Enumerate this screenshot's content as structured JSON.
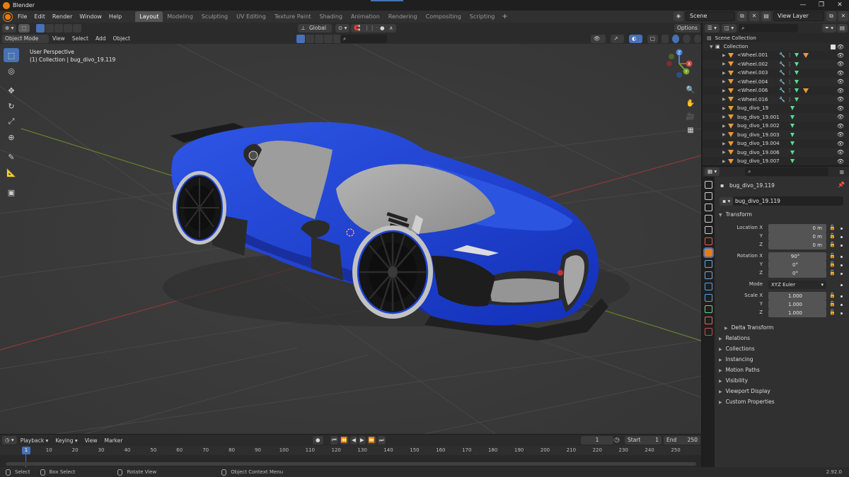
{
  "window": {
    "title": "Blender",
    "controls": [
      "—",
      "❐",
      "✕"
    ]
  },
  "menubar": {
    "menus": [
      "File",
      "Edit",
      "Render",
      "Window",
      "Help"
    ],
    "workspaces": [
      "Layout",
      "Modeling",
      "Sculpting",
      "UV Editing",
      "Texture Paint",
      "Shading",
      "Animation",
      "Rendering",
      "Compositing",
      "Scripting"
    ],
    "active_workspace": "Layout",
    "add_workspace": "+",
    "scene": "Scene",
    "view_layer": "View Layer"
  },
  "viewport_header": {
    "mode": "Object Mode",
    "menus": [
      "View",
      "Select",
      "Add",
      "Object"
    ],
    "orientation": "Global",
    "options": "Options"
  },
  "viewport": {
    "perspective": "User Perspective",
    "collection_info": "(1) Collection | bug_divo_19.119",
    "gizmo_axes": {
      "x": "X",
      "y": "Y",
      "z": "Z"
    },
    "accent_colors": {
      "car_body": "#1f3fc8",
      "x_axis": "#9c3a3a",
      "y_axis": "#6d8a2d",
      "active": "#4772b3"
    }
  },
  "tools": [
    {
      "name": "select-box-tool",
      "glyph": "⬚"
    },
    {
      "name": "cursor-tool",
      "glyph": "◎"
    },
    {
      "name": "move-tool",
      "glyph": "✥"
    },
    {
      "name": "rotate-tool",
      "glyph": "↻"
    },
    {
      "name": "scale-tool",
      "glyph": "⤢"
    },
    {
      "name": "transform-tool",
      "glyph": "⊕"
    },
    {
      "name": "annotate-tool",
      "glyph": "✎"
    },
    {
      "name": "measure-tool",
      "glyph": "📐"
    },
    {
      "name": "add-cube-tool",
      "glyph": "▣"
    }
  ],
  "nav_tools": [
    {
      "name": "zoom-icon",
      "glyph": "🔍"
    },
    {
      "name": "pan-hand-icon",
      "glyph": "✋"
    },
    {
      "name": "camera-view-icon",
      "glyph": "🎥"
    },
    {
      "name": "grid-ortho-icon",
      "glyph": "▦"
    }
  ],
  "timeline": {
    "menus": [
      "Playback",
      "Keying",
      "View",
      "Marker"
    ],
    "current_frame": "1",
    "start_label": "Start",
    "start": "1",
    "end_label": "End",
    "end": "250",
    "ticks": [
      "1",
      "10",
      "20",
      "30",
      "40",
      "50",
      "60",
      "70",
      "80",
      "90",
      "100",
      "110",
      "120",
      "130",
      "140",
      "150",
      "160",
      "170",
      "180",
      "190",
      "200",
      "210",
      "220",
      "230",
      "240",
      "250"
    ]
  },
  "statusbar": {
    "select": "Select",
    "box_select": "Box Select",
    "rotate_view": "Rotate View",
    "context_menu": "Object Context Menu",
    "version": "2.92.0"
  },
  "outliner": {
    "scene_collection": "Scene Collection",
    "collection": "Collection",
    "items": [
      {
        "name": "<Wheel.001",
        "mods": true,
        "orange": true
      },
      {
        "name": "<Wheel.002",
        "mods": true,
        "orange": false
      },
      {
        "name": "<Wheel.003",
        "mods": true,
        "orange": false
      },
      {
        "name": "<Wheel.004",
        "mods": true,
        "orange": false
      },
      {
        "name": "<Wheel.006",
        "mods": true,
        "orange": true
      },
      {
        "name": "<Wheel.016",
        "mods": true,
        "orange": false
      },
      {
        "name": "bug_divo_19",
        "mods": false,
        "orange": false
      },
      {
        "name": "bug_divo_19.001",
        "mods": false,
        "orange": false
      },
      {
        "name": "bug_divo_19.002",
        "mods": false,
        "orange": false
      },
      {
        "name": "bug_divo_19.003",
        "mods": false,
        "orange": false
      },
      {
        "name": "bug_divo_19.004",
        "mods": false,
        "orange": false
      },
      {
        "name": "bug_divo_19.006",
        "mods": false,
        "orange": false
      },
      {
        "name": "bug_divo_19.007",
        "mods": false,
        "orange": false
      }
    ]
  },
  "properties": {
    "object_title": "bug_divo_19.119",
    "object_name": "bug_divo_19.119",
    "transform_label": "Transform",
    "location": {
      "label_x": "Location X",
      "label_y": "Y",
      "label_z": "Z",
      "x": "0 m",
      "y": "0 m",
      "z": "0 m"
    },
    "rotation": {
      "label_x": "Rotation X",
      "label_y": "Y",
      "label_z": "Z",
      "x": "90°",
      "y": "0°",
      "z": "0°"
    },
    "mode_label": "Mode",
    "mode": "XYZ Euler",
    "scale": {
      "label_x": "Scale X",
      "label_y": "Y",
      "label_z": "Z",
      "x": "1.000",
      "y": "1.000",
      "z": "1.000"
    },
    "delta_transform": "Delta Transform",
    "sections": [
      "Relations",
      "Collections",
      "Instancing",
      "Motion Paths",
      "Visibility",
      "Viewport Display",
      "Custom Properties"
    ],
    "tab_colors": [
      "#cfcfcf",
      "#cfcfcf",
      "#cfcfcf",
      "#cfcfcf",
      "#cfcfcf",
      "#e55b5b",
      "#e87d0d",
      "#6fa8dc",
      "#6fa8dc",
      "#5ba3e0",
      "#5ba3e0",
      "#5fd98f",
      "#d56b6b",
      "#c94e4e"
    ]
  }
}
